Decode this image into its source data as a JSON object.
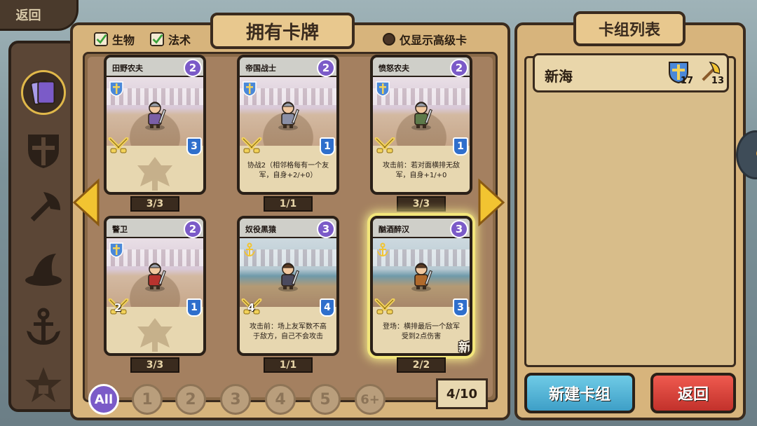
{
  "top_back": {
    "label": "返回"
  },
  "title_tab": {
    "label": "拥有卡牌"
  },
  "filters": {
    "creature": {
      "label": "生物",
      "checked": true
    },
    "spell": {
      "label": "法术",
      "checked": true
    },
    "premium_only": {
      "label": "仅显示高级卡",
      "checked": false
    }
  },
  "left_rail": {
    "items": [
      {
        "icon": "cards-icon",
        "active": true
      },
      {
        "icon": "shield-cross-icon",
        "active": false
      },
      {
        "icon": "axe-icon",
        "active": false
      },
      {
        "icon": "witch-hat-icon",
        "active": false
      },
      {
        "icon": "anchor-icon",
        "active": false
      },
      {
        "icon": "locked-star-icon",
        "active": false
      }
    ]
  },
  "cards": [
    {
      "name": "田野农夫",
      "cost": "2",
      "faction_icon": "shield-cross-icon",
      "attack": "",
      "health": "3",
      "text": "",
      "count": "3/3",
      "new": "",
      "art": "palace",
      "unit_color": "#7a5fa6"
    },
    {
      "name": "帝国战士",
      "cost": "2",
      "faction_icon": "shield-cross-icon",
      "attack": "",
      "health": "1",
      "text": "协战2（相邻格每有一个友军，自身+2/+0）",
      "count": "1/1",
      "new": "",
      "art": "palace",
      "unit_color": "#8a8fa6"
    },
    {
      "name": "愤怒农夫",
      "cost": "2",
      "faction_icon": "shield-cross-icon",
      "attack": "",
      "health": "1",
      "text": "攻击前：若对面横排无敌军，自身+1/+0",
      "count": "3/3",
      "new": "",
      "art": "palace",
      "unit_color": "#5d7a4a"
    },
    {
      "name": "警卫",
      "cost": "2",
      "faction_icon": "shield-cross-icon",
      "attack": "2",
      "health": "1",
      "text": "",
      "count": "3/3",
      "new": "",
      "art": "palace",
      "unit_color": "#b8332e"
    },
    {
      "name": "奴役黑猿",
      "cost": "3",
      "faction_icon": "anchor-icon",
      "attack": "4",
      "health": "4",
      "text": "攻击前：场上友军数不高于敌方，自己不会攻击",
      "count": "1/1",
      "new": "",
      "art": "harbor",
      "unit_color": "#4b4a5e"
    },
    {
      "name": "酗酒醉汉",
      "cost": "3",
      "faction_icon": "anchor-icon",
      "attack": "",
      "health": "3",
      "text": "登场：横排最后一个敌军受到2点伤害",
      "count": "2/2",
      "new": "新",
      "art": "harbor",
      "unit_color": "#b06a2c"
    }
  ],
  "cost_filters": [
    "All",
    "1",
    "2",
    "3",
    "4",
    "5",
    "6+"
  ],
  "page": "4/10",
  "deck_panel": {
    "title": "卡组列表",
    "decks": [
      {
        "name": "新海",
        "shield_count": "17",
        "axe_count": "13"
      }
    ],
    "new_deck_label": "新建卡组",
    "back_label": "返回"
  },
  "colors": {
    "panel": "#d7b47c",
    "frame": "#3a2b1e",
    "cost_purple": "#7b5bc8",
    "health_blue": "#2f6fcc",
    "new_button": "#3e9fc7",
    "back_button": "#c2312b"
  }
}
